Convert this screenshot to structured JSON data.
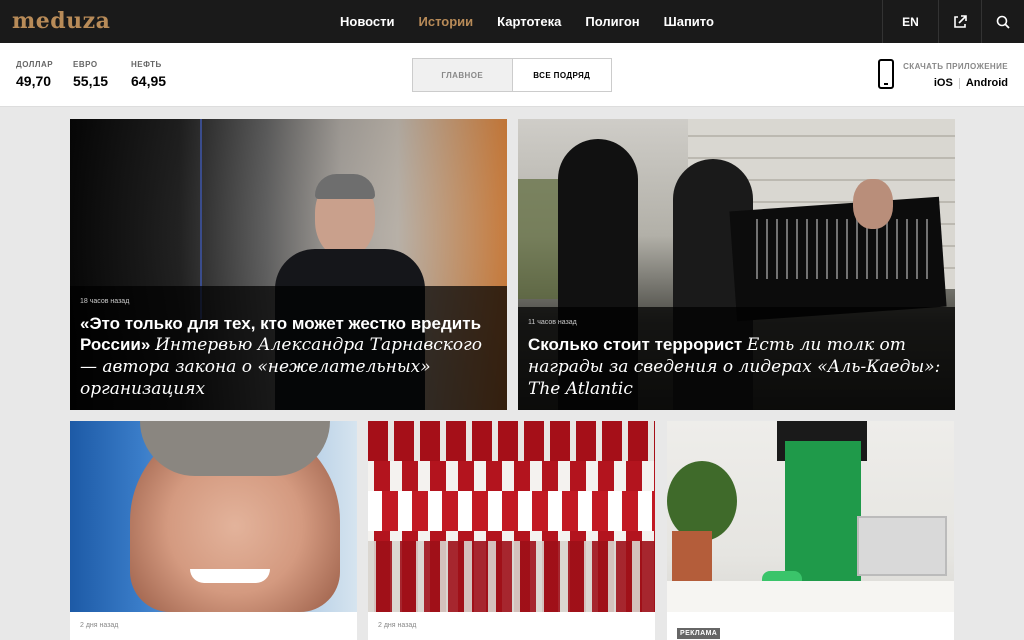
{
  "header": {
    "logo": "meduza",
    "nav": [
      "Новости",
      "Истории",
      "Картотека",
      "Полигон",
      "Шапито"
    ],
    "nav_active_index": 1,
    "lang": "EN"
  },
  "rates": [
    {
      "label": "ДОЛЛАР",
      "value": "49,70"
    },
    {
      "label": "ЕВРО",
      "value": "55,15"
    },
    {
      "label": "НЕФТЬ",
      "value": "64,95"
    }
  ],
  "toggle": {
    "main": "ГЛАВНОЕ",
    "all": "ВСЕ ПОДРЯД"
  },
  "app": {
    "label": "СКАЧАТЬ ПРИЛОЖЕНИЕ",
    "ios": "iOS",
    "android": "Android"
  },
  "cards": {
    "c1": {
      "time": "18 часов назад",
      "title_bold": "«Это только для тех, кто может жестко вредить России»",
      "title_italic": "Интервью Александра Тарнавского — автора закона о «нежелательных» организациях"
    },
    "c2": {
      "time": "11 часов назад",
      "title_bold": "Сколько стоит террорист",
      "title_italic": "Есть ли толк от награды за сведения о лидерах «Аль-Каеды»: The Atlantic"
    },
    "c3": {
      "time": "2 дня назад"
    },
    "c4": {
      "time": "2 дня назад"
    },
    "c5": {
      "badge": "РЕКЛАМА"
    }
  },
  "colors": {
    "accent": "#b88b58",
    "topbar": "#1a1a1a",
    "background": "#e8e8e8"
  }
}
